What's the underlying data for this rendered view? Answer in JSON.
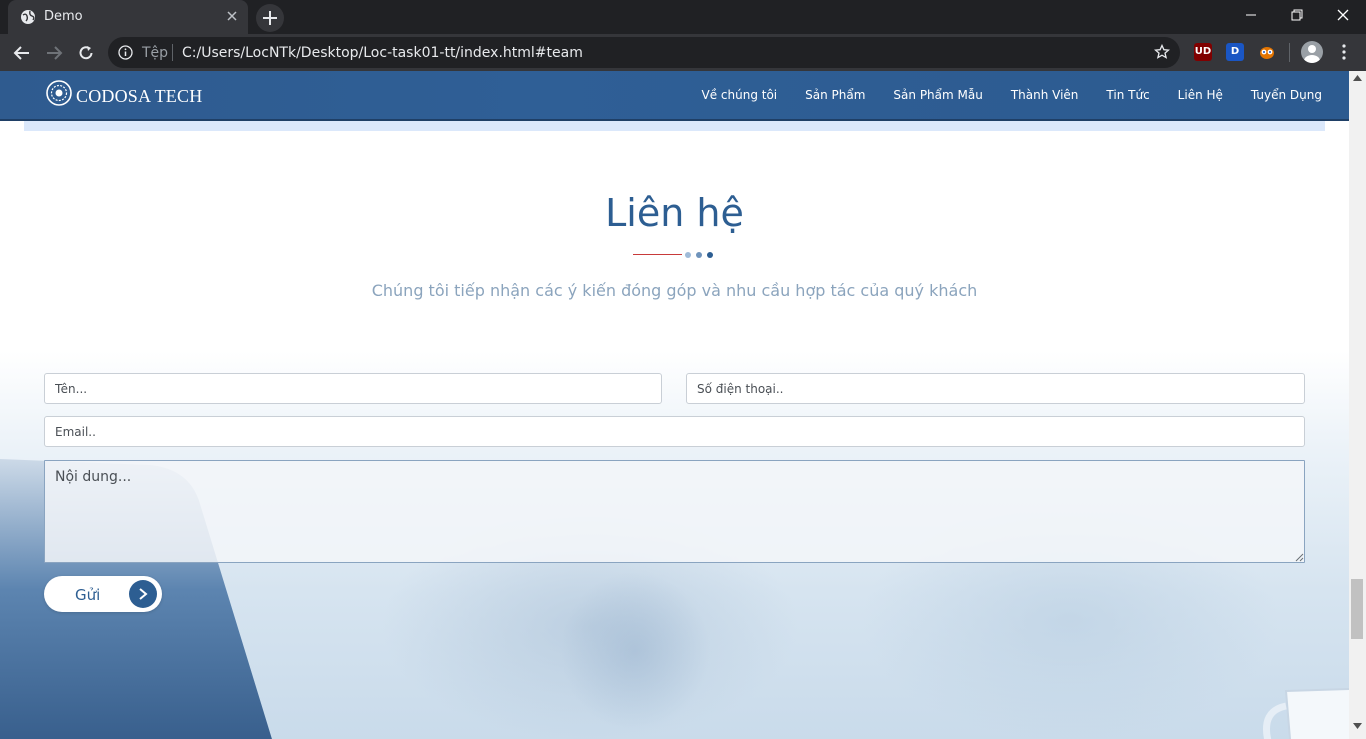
{
  "browser": {
    "tab_title": "Demo",
    "omnibox_scheme": "Tệp",
    "url": "C:/Users/LocNTk/Desktop/Loc-task01-tt/index.html#team",
    "extensions": [
      {
        "name": "ublock-icon",
        "label": "UD",
        "color": "#800000"
      },
      {
        "name": "dashlane-icon",
        "label": "D",
        "color": "#1a73e8"
      },
      {
        "name": "owl-extension-icon",
        "label": "",
        "color": "#e37400"
      }
    ]
  },
  "site": {
    "logo_text": "CODOSA TECH",
    "nav": [
      "Về chúng tôi",
      "Sản Phẩm",
      "Sản Phẩm Mẫu",
      "Thành Viên",
      "Tin Tức",
      "Liên Hệ",
      "Tuyển Dụng"
    ]
  },
  "contact": {
    "title": "Liên hệ",
    "subtitle": "Chúng tôi tiếp nhận các ý kiến đóng góp và nhu cầu hợp tác của quý khách",
    "name_placeholder": "Tên...",
    "phone_placeholder": "Số điện thoại..",
    "email_placeholder": "Email..",
    "message_placeholder": "Nội dung...",
    "submit_label": "Gửi"
  },
  "colors": {
    "header": "#2f5b8f",
    "accent": "#2d5e92",
    "divider_red": "#c83a3a",
    "dots": [
      "#9fbbd8",
      "#6f93bb",
      "#2d5e92"
    ]
  }
}
